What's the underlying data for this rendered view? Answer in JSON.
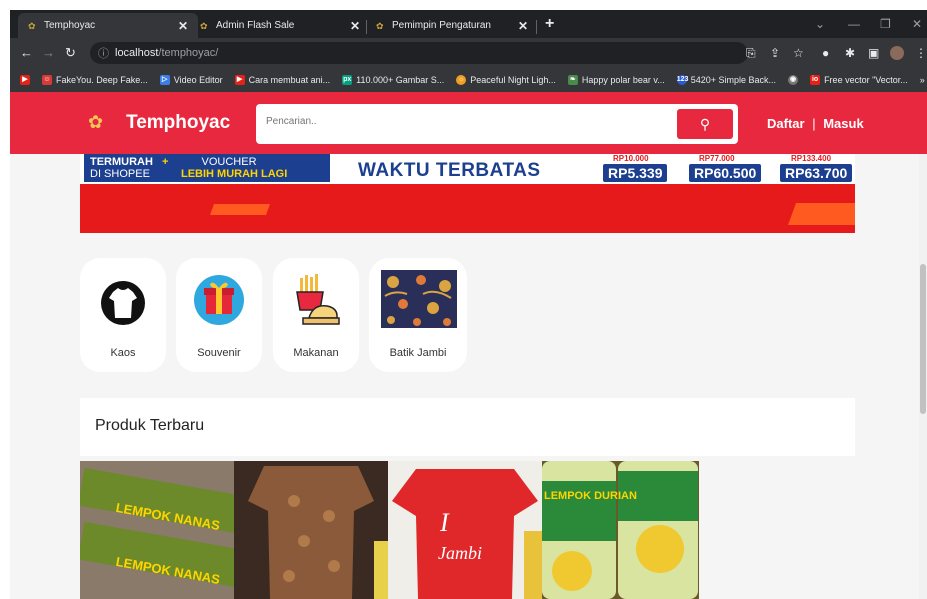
{
  "tabs": [
    {
      "title": "Temphoyac",
      "active": true
    },
    {
      "title": "Admin Flash Sale",
      "active": false
    },
    {
      "title": "Pemimpin Pengaturan",
      "active": false
    }
  ],
  "address": {
    "host": "localhost",
    "path": "/temphoyac/"
  },
  "bookmarks": [
    "FakeYou. Deep Fake...",
    "Video Editor",
    "Cara membuat ani...",
    "110.000+ Gambar S...",
    "Peaceful Night Ligh...",
    "Happy polar bear v...",
    "5420+ Simple Back...",
    "Free vector \"Vector..."
  ],
  "site": {
    "brand": "Temphoyac",
    "search_placeholder": "Pencarian..",
    "register": "Daftar",
    "separator": "|",
    "login": "Masuk",
    "brand_color": "#e8283f"
  },
  "banner": {
    "left_line1": "TERMURAH",
    "left_line2": "DI SHOPEE",
    "voucher_line1": "VOUCHER",
    "voucher_line2": "LEBIH MURAH LAGI",
    "title": "WAKTU TERBATAS",
    "prices": [
      "RP5.339",
      "RP60.500",
      "RP63.700"
    ],
    "old_prices": [
      "RP10.000",
      "RP77.000",
      "RP133.400"
    ]
  },
  "categories": [
    "Kaos",
    "Souvenir",
    "Makanan",
    "Batik Jambi"
  ],
  "products_section": {
    "title": "Produk Terbaru",
    "items": [
      {
        "image_text": "LEMPOK NANAS"
      },
      {
        "image_text": ""
      },
      {
        "image_text": "Jambi"
      },
      {
        "image_text": "LEMPOK DURIAN"
      }
    ]
  }
}
